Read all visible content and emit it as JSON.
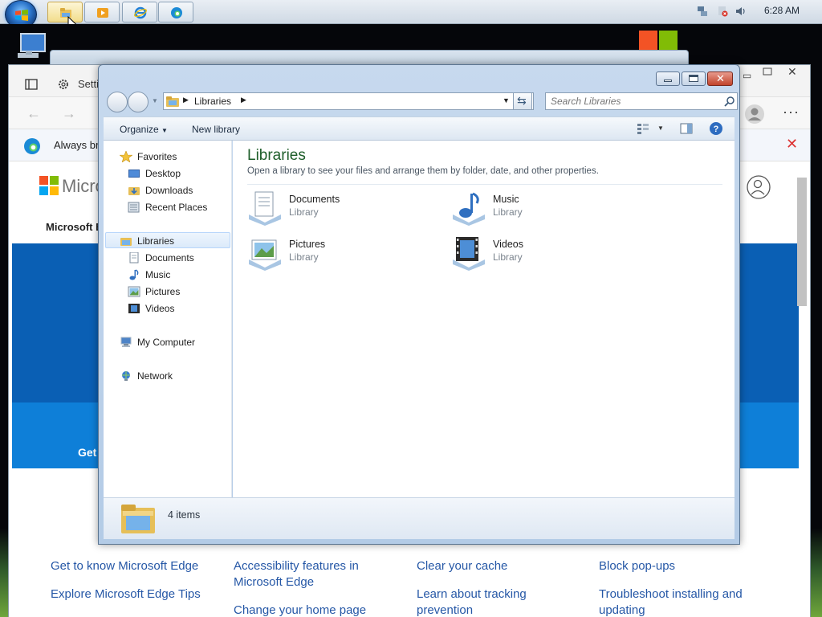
{
  "taskbar": {
    "clock": "6:28 AM",
    "buttons": [
      "file-explorer",
      "media-player",
      "internet-explorer",
      "microsoft-edge"
    ]
  },
  "edge_background": {
    "settings_tab": "Setti",
    "info_text": "Always bri",
    "brand": "Micro",
    "nav_label": "Microsoft E",
    "hero_button": "Get",
    "links": [
      "Get to know Microsoft Edge",
      "Explore Microsoft Edge Tips",
      "Accessibility features in Microsoft Edge",
      "Change your home page",
      "Clear your cache",
      "Learn about tracking prevention",
      "Block pop-ups",
      "Troubleshoot installing and updating"
    ]
  },
  "explorer": {
    "breadcrumb": "Libraries",
    "search_placeholder": "Search Libraries",
    "commands": {
      "organize": "Organize",
      "new_library": "New library"
    },
    "nav_tree": {
      "favorites": "Favorites",
      "desktop": "Desktop",
      "downloads": "Downloads",
      "recent_places": "Recent Places",
      "libraries": "Libraries",
      "documents": "Documents",
      "music": "Music",
      "pictures": "Pictures",
      "videos": "Videos",
      "my_computer": "My Computer",
      "network": "Network"
    },
    "content": {
      "title": "Libraries",
      "description": "Open a library to see your files and arrange them by folder, date, and other properties.",
      "libraries": [
        {
          "name": "Documents",
          "type": "Library"
        },
        {
          "name": "Music",
          "type": "Library"
        },
        {
          "name": "Pictures",
          "type": "Library"
        },
        {
          "name": "Videos",
          "type": "Library"
        }
      ]
    },
    "details": {
      "count": "4 items"
    }
  }
}
